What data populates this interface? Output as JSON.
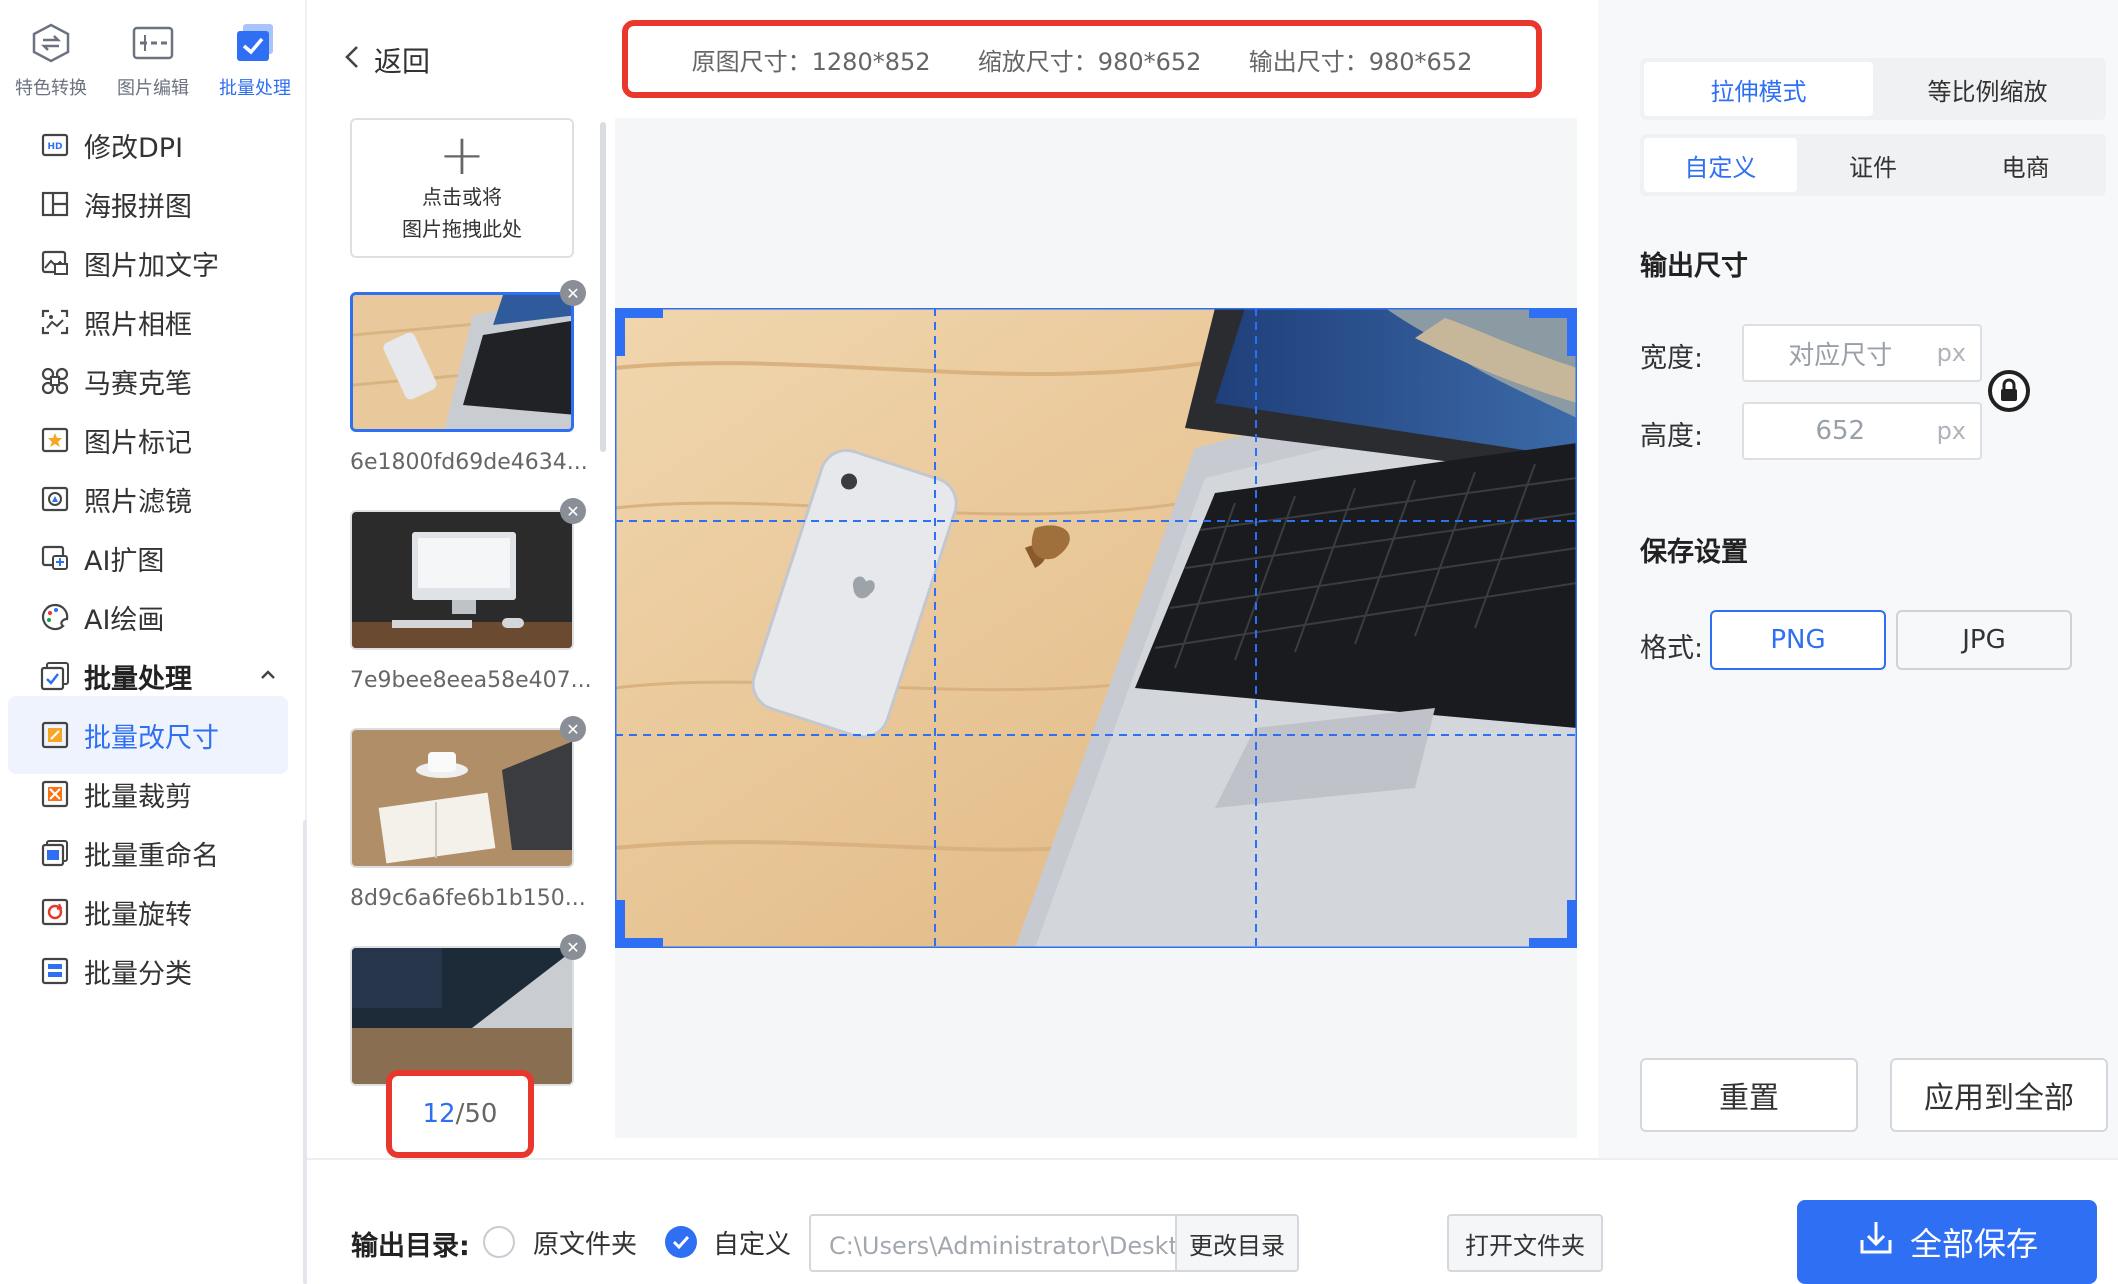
{
  "sidebar": {
    "top_tabs": [
      {
        "label": "特色转换",
        "icon": "convert-icon"
      },
      {
        "label": "图片编辑",
        "icon": "image-edit-icon"
      },
      {
        "label": "批量处理",
        "icon": "batch-check-icon",
        "active": true
      }
    ],
    "items": [
      {
        "label": "修改DPI",
        "icon": "dpi-icon"
      },
      {
        "label": "海报拼图",
        "icon": "poster-collage-icon"
      },
      {
        "label": "图片加文字",
        "icon": "add-text-icon"
      },
      {
        "label": "照片相框",
        "icon": "photo-frame-icon"
      },
      {
        "label": "马赛克笔",
        "icon": "mosaic-icon"
      },
      {
        "label": "图片标记",
        "icon": "mark-icon"
      },
      {
        "label": "照片滤镜",
        "icon": "filter-icon"
      },
      {
        "label": "AI扩图",
        "icon": "ai-expand-icon"
      },
      {
        "label": "AI绘画",
        "icon": "ai-paint-icon"
      },
      {
        "label": "批量处理",
        "icon": "batch-group-icon",
        "group": true
      },
      {
        "label": "批量改尺寸",
        "icon": "batch-resize-icon",
        "selected": true
      },
      {
        "label": "批量裁剪",
        "icon": "batch-crop-icon"
      },
      {
        "label": "批量重命名",
        "icon": "batch-rename-icon"
      },
      {
        "label": "批量旋转",
        "icon": "batch-rotate-icon"
      },
      {
        "label": "批量分类",
        "icon": "batch-sort-icon"
      }
    ]
  },
  "header": {
    "back_label": "返回",
    "original_size": "原图尺寸：1280*852",
    "scaled_size": "缩放尺寸：980*652",
    "output_size": "输出尺寸：980*652"
  },
  "upload": {
    "line1": "点击或将",
    "line2": "图片拖拽此处"
  },
  "thumbnails": [
    {
      "name": "6e1800fd69de4634...",
      "active": true
    },
    {
      "name": "7e9bee8eea58e407..."
    },
    {
      "name": "8d9c6a6fe6b1b150..."
    },
    {
      "name": ""
    }
  ],
  "counter": {
    "current": "12",
    "sep": "/",
    "total": "50"
  },
  "panel": {
    "mode_tabs": [
      "拉伸模式",
      "等比例缩放"
    ],
    "preset_tabs": [
      "自定义",
      "证件",
      "电商"
    ],
    "output_size_title": "输出尺寸",
    "width_label": "宽度:",
    "width_placeholder": "对应尺寸",
    "width_unit": "px",
    "height_label": "高度:",
    "height_value": "652",
    "height_unit": "px",
    "save_title": "保存设置",
    "format_label": "格式:",
    "formats": [
      "PNG",
      "JPG"
    ],
    "reset_label": "重置",
    "apply_all_label": "应用到全部"
  },
  "bottom": {
    "output_dir_label": "输出目录:",
    "radio_original": "原文件夹",
    "radio_custom": "自定义",
    "path": "C:\\Users\\Administrator\\Desktop\\图片",
    "change_dir": "更改目录",
    "open_folder": "打开文件夹",
    "save_all": "全部保存"
  },
  "colors": {
    "accent": "#2f6ff3",
    "highlight_box": "#e8372d"
  }
}
